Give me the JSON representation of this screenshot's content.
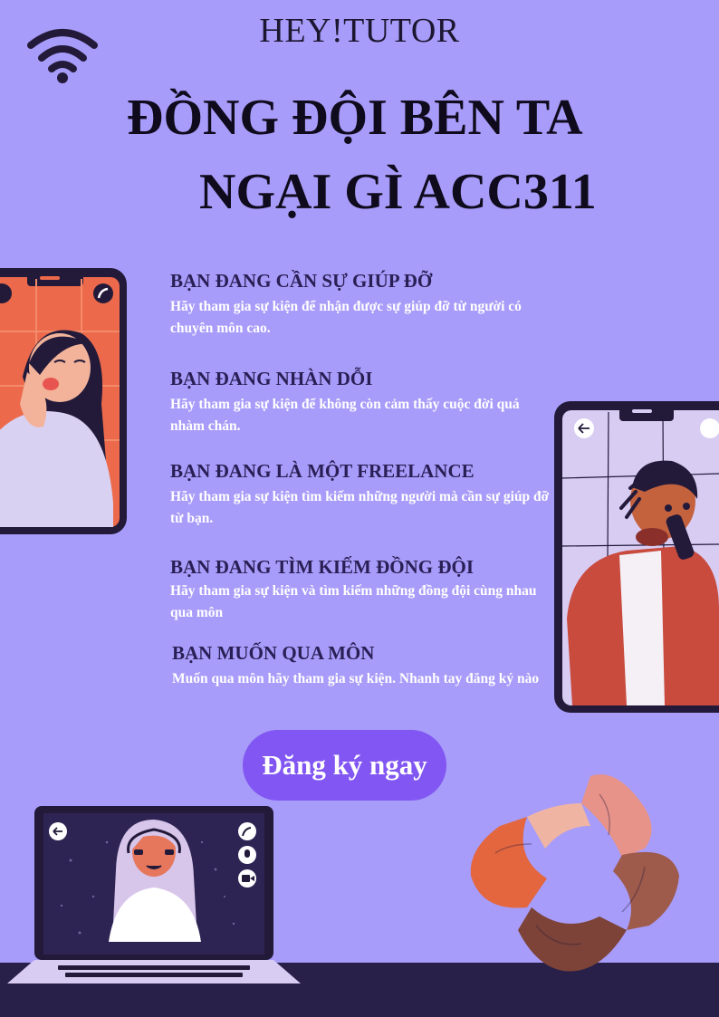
{
  "header": {
    "brand": "HEY!TUTOR",
    "title_line1": "ĐỒNG ĐỘI BÊN TA",
    "title_line2": "NGẠI GÌ ACC311"
  },
  "items": [
    {
      "heading": "BẠN ĐANG CẦN SỰ GIÚP ĐỠ",
      "text": "Hãy tham gia sự kiện để nhận được sự giúp đỡ từ người có chuyên môn cao."
    },
    {
      "heading": "BẠN ĐANG NHÀN DỖI",
      "text": "Hãy tham gia sự kiện để không còn cảm thấy cuộc đời quá nhàm chán."
    },
    {
      "heading": "BẠN ĐANG LÀ MỘT FREELANCE",
      "text": "Hãy tham gia sự kiện tìm kiếm những người mà cần sự giúp đỡ từ bạn."
    },
    {
      "heading": "BẠN ĐANG TÌM KIẾM ĐỒNG ĐỘI",
      "text": "Hãy tham gia sự kiện và tìm kiếm những đồng đội cùng nhau qua môn"
    },
    {
      "heading": "BẠN MUỐN QUA MÔN",
      "text": "Muốn qua môn hãy tham gia sự kiện. Nhanh tay đăng ký nào"
    }
  ],
  "cta": {
    "label": "Đăng ký ngay"
  },
  "icons": {
    "wifi": "wifi-icon",
    "back": "arrow-left-icon",
    "call": "phone-icon",
    "mic": "microphone-icon",
    "video": "video-camera-icon"
  },
  "colors": {
    "background": "#a79cf9",
    "accent": "#8156f2",
    "dark": "#292049",
    "heading": "#2a1f55"
  }
}
